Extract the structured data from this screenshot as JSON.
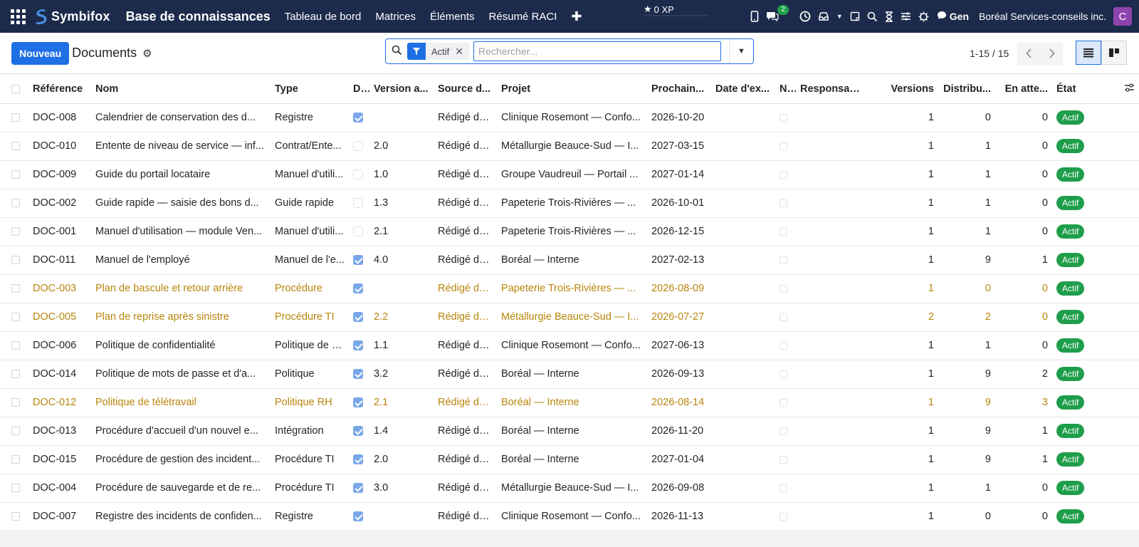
{
  "navbar": {
    "brand": "Symbifox",
    "app_title": "Base de connaissances",
    "menu": [
      "Tableau de bord",
      "Matrices",
      "Éléments",
      "Résumé RACI"
    ],
    "xp": "0 XP",
    "messages_count": "2",
    "gen_label": "Gen",
    "company": "Boréal Services-conseils inc.",
    "avatar_letter": "C"
  },
  "control": {
    "new_label": "Nouveau",
    "title": "Documents",
    "facet_label": "Actif",
    "search_placeholder": "Rechercher...",
    "pager": "1-15 / 15"
  },
  "table": {
    "columns": [
      "Référence",
      "Nom",
      "Type",
      "D...",
      "Version a...",
      "Source d...",
      "Projet",
      "Prochain...",
      "Date d'ex...",
      "N...",
      "Responsable",
      "Versions",
      "Distribu...",
      "En atte...",
      "État"
    ],
    "rows": [
      {
        "ref": "DOC-008",
        "name": "Calendrier de conservation des d...",
        "type": "Registre",
        "d": true,
        "version": "",
        "source": "Rédigé da...",
        "project": "Clinique Rosemont — Confo...",
        "next": "2026-10-20",
        "exp": "",
        "versions": "1",
        "dist": "0",
        "pending": "0",
        "state": "Actif",
        "warn": false
      },
      {
        "ref": "DOC-010",
        "name": "Entente de niveau de service — inf...",
        "type": "Contrat/Ente...",
        "d": false,
        "version": "2.0",
        "source": "Rédigé da...",
        "project": "Métallurgie Beauce-Sud — I...",
        "next": "2027-03-15",
        "exp": "",
        "versions": "1",
        "dist": "1",
        "pending": "0",
        "state": "Actif",
        "warn": false
      },
      {
        "ref": "DOC-009",
        "name": "Guide du portail locataire",
        "type": "Manuel d'utili...",
        "d": false,
        "version": "1.0",
        "source": "Rédigé da...",
        "project": "Groupe Vaudreuil — Portail ...",
        "next": "2027-01-14",
        "exp": "",
        "versions": "1",
        "dist": "1",
        "pending": "0",
        "state": "Actif",
        "warn": false
      },
      {
        "ref": "DOC-002",
        "name": "Guide rapide — saisie des bons d...",
        "type": "Guide rapide",
        "d": false,
        "version": "1.3",
        "source": "Rédigé da...",
        "project": "Papeterie Trois-Rivières — ...",
        "next": "2026-10-01",
        "exp": "",
        "versions": "1",
        "dist": "1",
        "pending": "0",
        "state": "Actif",
        "warn": false
      },
      {
        "ref": "DOC-001",
        "name": "Manuel d'utilisation — module Ven...",
        "type": "Manuel d'utili...",
        "d": false,
        "version": "2.1",
        "source": "Rédigé da...",
        "project": "Papeterie Trois-Rivières — ...",
        "next": "2026-12-15",
        "exp": "",
        "versions": "1",
        "dist": "1",
        "pending": "0",
        "state": "Actif",
        "warn": false
      },
      {
        "ref": "DOC-011",
        "name": "Manuel de l'employé",
        "type": "Manuel de l'e...",
        "d": true,
        "version": "4.0",
        "source": "Rédigé da...",
        "project": "Boréal — Interne",
        "next": "2027-02-13",
        "exp": "",
        "versions": "1",
        "dist": "9",
        "pending": "1",
        "state": "Actif",
        "warn": false
      },
      {
        "ref": "DOC-003",
        "name": "Plan de bascule et retour arrière",
        "type": "Procédure",
        "d": true,
        "version": "",
        "source": "Rédigé da...",
        "project": "Papeterie Trois-Rivières — ...",
        "next": "2026-08-09",
        "exp": "",
        "versions": "1",
        "dist": "0",
        "pending": "0",
        "state": "Actif",
        "warn": true
      },
      {
        "ref": "DOC-005",
        "name": "Plan de reprise après sinistre",
        "type": "Procédure TI",
        "d": true,
        "version": "2.2",
        "source": "Rédigé da...",
        "project": "Métallurgie Beauce-Sud — I...",
        "next": "2026-07-27",
        "exp": "",
        "versions": "2",
        "dist": "2",
        "pending": "0",
        "state": "Actif",
        "warn": true
      },
      {
        "ref": "DOC-006",
        "name": "Politique de confidentialité",
        "type": "Politique de c...",
        "d": true,
        "version": "1.1",
        "source": "Rédigé da...",
        "project": "Clinique Rosemont — Confo...",
        "next": "2027-06-13",
        "exp": "",
        "versions": "1",
        "dist": "1",
        "pending": "0",
        "state": "Actif",
        "warn": false
      },
      {
        "ref": "DOC-014",
        "name": "Politique de mots de passe et d'a...",
        "type": "Politique",
        "d": true,
        "version": "3.2",
        "source": "Rédigé da...",
        "project": "Boréal — Interne",
        "next": "2026-09-13",
        "exp": "",
        "versions": "1",
        "dist": "9",
        "pending": "2",
        "state": "Actif",
        "warn": false
      },
      {
        "ref": "DOC-012",
        "name": "Politique de télétravail",
        "type": "Politique RH",
        "d": true,
        "version": "2.1",
        "source": "Rédigé da...",
        "project": "Boréal — Interne",
        "next": "2026-08-14",
        "exp": "",
        "versions": "1",
        "dist": "9",
        "pending": "3",
        "state": "Actif",
        "warn": true
      },
      {
        "ref": "DOC-013",
        "name": "Procédure d'accueil d'un nouvel e...",
        "type": "Intégration",
        "d": true,
        "version": "1.4",
        "source": "Rédigé da...",
        "project": "Boréal — Interne",
        "next": "2026-11-20",
        "exp": "",
        "versions": "1",
        "dist": "9",
        "pending": "1",
        "state": "Actif",
        "warn": false
      },
      {
        "ref": "DOC-015",
        "name": "Procédure de gestion des incident...",
        "type": "Procédure TI",
        "d": true,
        "version": "2.0",
        "source": "Rédigé da...",
        "project": "Boréal — Interne",
        "next": "2027-01-04",
        "exp": "",
        "versions": "1",
        "dist": "9",
        "pending": "1",
        "state": "Actif",
        "warn": false
      },
      {
        "ref": "DOC-004",
        "name": "Procédure de sauvegarde et de re...",
        "type": "Procédure TI",
        "d": true,
        "version": "3.0",
        "source": "Rédigé da...",
        "project": "Métallurgie Beauce-Sud — I...",
        "next": "2026-09-08",
        "exp": "",
        "versions": "1",
        "dist": "1",
        "pending": "0",
        "state": "Actif",
        "warn": false
      },
      {
        "ref": "DOC-007",
        "name": "Registre des incidents de confiden...",
        "type": "Registre",
        "d": true,
        "version": "",
        "source": "Rédigé da...",
        "project": "Clinique Rosemont — Confo...",
        "next": "2026-11-13",
        "exp": "",
        "versions": "1",
        "dist": "0",
        "pending": "0",
        "state": "Actif",
        "warn": false
      }
    ]
  },
  "colors": {
    "navbar": "#1c2b4b",
    "primary": "#1f6fe5",
    "warn_text": "#b8860b",
    "state_badge": "#1e9e4a",
    "avatar": "#8e44ad"
  }
}
